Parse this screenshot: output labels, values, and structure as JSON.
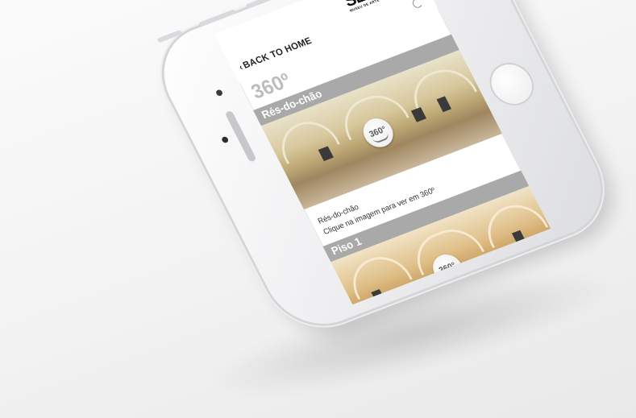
{
  "header": {
    "back_label": "BACK TO HOME",
    "back_chevron": "‹",
    "logo_title": "SERRAVES",
    "logo_subtitle": "MUSEU DE ARTE CONTEMPORÂNEA",
    "refresh_icon": "refresh-icon"
  },
  "page": {
    "title": "360º"
  },
  "sections": [
    {
      "bar_label": "Rés-do-chão",
      "badge": "360°",
      "caption_title": "Rés-do-chão",
      "caption_text": "Clique na imagem para ver em 360º"
    },
    {
      "bar_label": "Piso 1",
      "badge": "360°"
    }
  ],
  "colors": {
    "section_bar": "#a9a9a9",
    "page_title": "#bdbdbd",
    "phone_body": "#f1f1f3"
  }
}
